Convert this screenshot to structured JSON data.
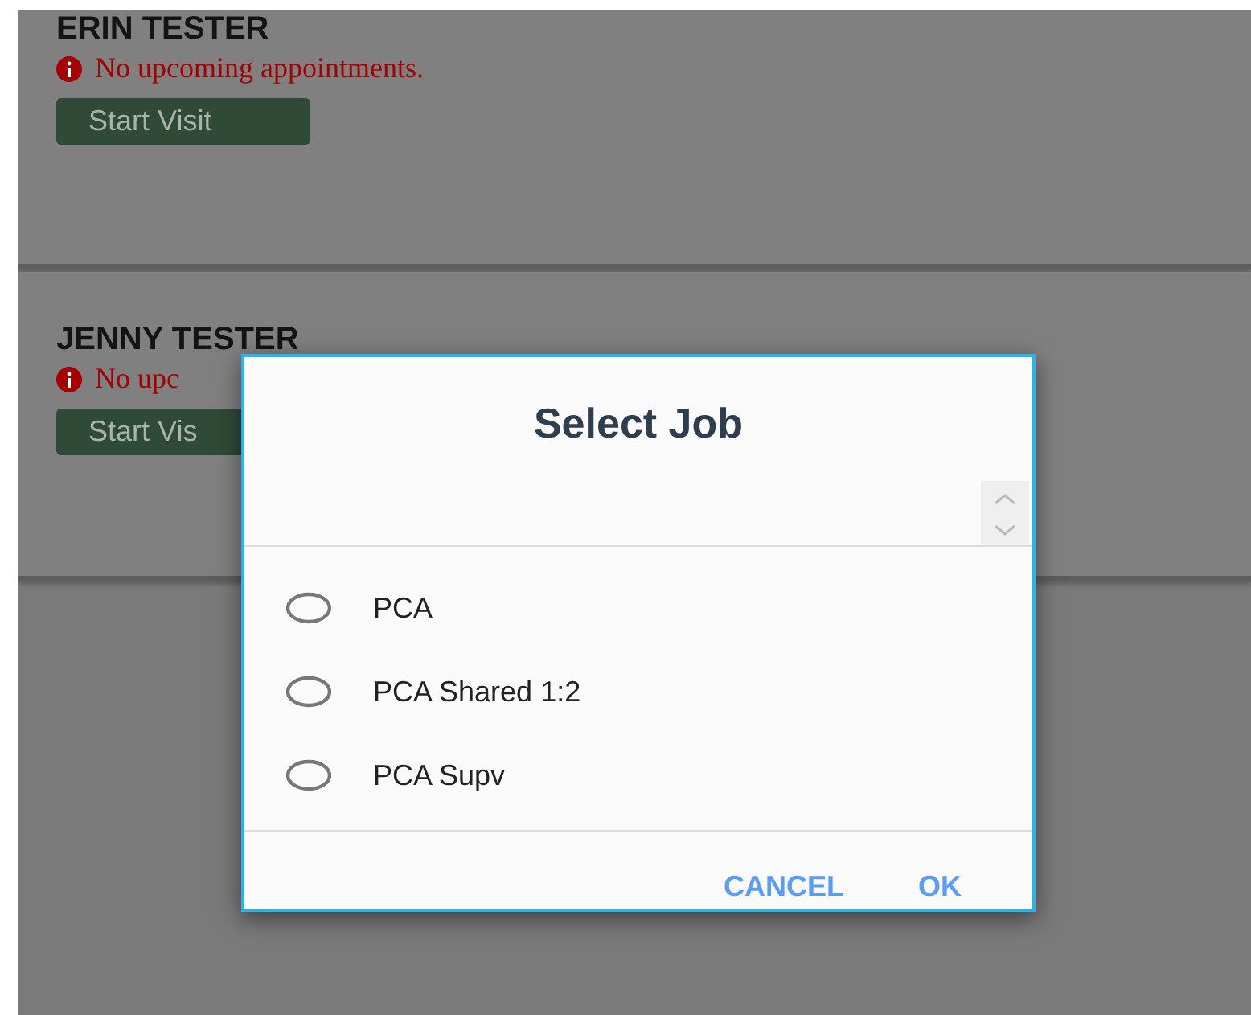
{
  "patients": [
    {
      "name": "ERIN TESTER",
      "message": "No upcoming appointments.",
      "button": "Start Visit"
    },
    {
      "name": "JENNY TESTER",
      "message": "No upc",
      "button": "Start Vis"
    }
  ],
  "dialog": {
    "title": "Select Job",
    "options": [
      {
        "label": "PCA",
        "selected": false
      },
      {
        "label": "PCA Shared 1:2",
        "selected": false
      },
      {
        "label": "PCA Supv",
        "selected": false
      }
    ],
    "buttons": [
      "CANCEL",
      "OK"
    ]
  }
}
